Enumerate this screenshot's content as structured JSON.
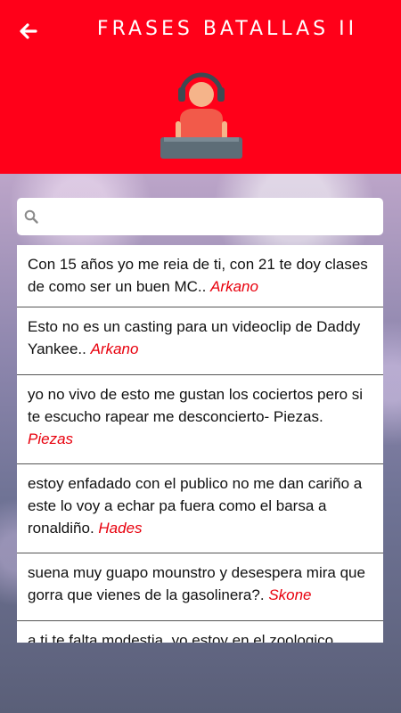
{
  "header": {
    "title": "FRASES BATALLAS II",
    "color": "#ff0019"
  },
  "icons": {
    "back": "arrow-left-icon",
    "logo": "dj-icon",
    "search": "search-icon"
  },
  "search": {
    "placeholder": "",
    "value": ""
  },
  "phrases": [
    {
      "text": "Con 15 años yo me reia de ti, con 21 te doy clases de como ser un buen MC..",
      "author": "Arkano"
    },
    {
      "text": "Esto no es un casting para un videoclip de Daddy Yankee..",
      "author": "Arkano"
    },
    {
      "text": "yo no vivo de esto me gustan los cociertos pero si te escucho rapear me desconcierto- Piezas.",
      "author": "Piezas"
    },
    {
      "text": "estoy enfadado con el publico no me dan cariño a este lo voy a echar pa fuera como el barsa a ronaldiño.",
      "author": "Hades"
    },
    {
      "text": "suena muy guapo mounstro y desespera mira que gorra que vienes de la gasolinera?.",
      "author": "Skone"
    },
    {
      "text": "a ti te falta modestia, yo estoy en el zoologico",
      "author": ""
    }
  ]
}
